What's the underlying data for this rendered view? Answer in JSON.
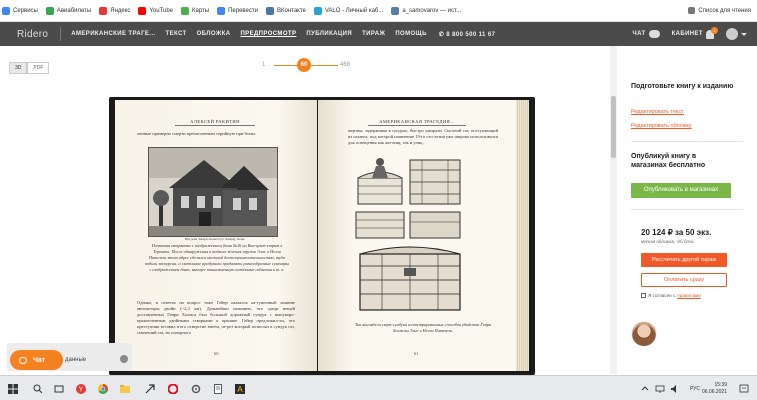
{
  "bookmarks": {
    "items": [
      {
        "label": "Сервисы",
        "icon": "apps-grid-icon",
        "color": "#4285f4"
      },
      {
        "label": "Авиабилеты",
        "icon": "plane-icon",
        "color": "#34a853"
      },
      {
        "label": "Яндекс",
        "icon": "yandex-icon",
        "color": "#e53935"
      },
      {
        "label": "YouTube",
        "icon": "youtube-icon",
        "color": "#ff0000"
      },
      {
        "label": "Карты",
        "icon": "maps-icon",
        "color": "#4caf50"
      },
      {
        "label": "Перевести",
        "icon": "translate-icon",
        "color": "#4285f4"
      },
      {
        "label": "ВКонтакте",
        "icon": "vk-icon",
        "color": "#4a76a8"
      },
      {
        "label": "VALO - Личный каб...",
        "icon": "valo-icon",
        "color": "#2aa0d6"
      },
      {
        "label": "a_samovarov — ист...",
        "icon": "livejournal-icon",
        "color": "#5a7fa6"
      }
    ],
    "reading_list": "Список для чтения"
  },
  "header": {
    "logo": "Ridero",
    "nav": [
      {
        "label": "АМЕРИКАНСКИЕ ТРАГЕ...",
        "active": false
      },
      {
        "label": "ТЕКСТ",
        "active": false
      },
      {
        "label": "ОБЛОЖКА",
        "active": false
      },
      {
        "label": "ПРЕДПРОСМОТР",
        "active": true
      },
      {
        "label": "ПУБЛИКАЦИЯ",
        "active": false
      },
      {
        "label": "ТИРАЖ",
        "active": false
      },
      {
        "label": "ПОМОЩЬ",
        "active": false
      }
    ],
    "phone": "8 800 500 11 67",
    "chat_label": "ЧАТ",
    "cabinet_label": "КАБИНЕТ",
    "notifications": "1"
  },
  "viewer": {
    "modes": [
      "3D",
      "PDF"
    ],
    "active_mode": "3D",
    "pager": {
      "min": "1",
      "current": "60",
      "max": "468"
    }
  },
  "book": {
    "left_page": {
      "running_head": "АЛЕКСЕЙ РАКИТИН",
      "top_text": "ленные примерно смерти пречисленным серийную при-боны.",
      "photo_caption_small": "Вид дома Эдварда Холмса (Ст. Ховард), Холмс",
      "caption": "Почтовая открытка с изображением дома №16 по Вин-цент-стрит в Торонто. После обнаружения в подвале зём-ная трупов Элис и Нелли Питезель этот адрес сделался местной достопримечательностью, туда водили экскурсии, а сметливое придумали продавать разнообразные сувениры с изображением дома, вьющее таинственную потёмные события и т. п.",
      "body": "Однако, в ответах на вопрос тоже Гейер оказался ка-тушенный лишние автомоторы двойн (~2,3 км). Дальнейши напомню, что среди вещей доставленных Генри Холмса был большой дорожный сундук с выпукоро-прокопченным двойными створками к крышке. Гейер предложил-ли, что преступник вставил в его отверстие змеем, че-рез который позволял в сундук газ, смочеший газ, но изнорного",
      "page_number": "60"
    },
    "right_page": {
      "running_head": "АМЕРИКАНСКАЯ ТРАГЕДИЯ...",
      "top_text": "жертвы, задерживая в сундуке, быстро умирали. Сыгчеий газ, поступающий из шланга, под которой появление 19-го сто-летия уже широко использовался для освещения как жи-лищ, так и улиц.",
      "caption": "Так выглядели сверх-сундуки иллюстрированных способов убийства Генри Холмсом Элис и Нелли Питезель.",
      "page_number": "61"
    }
  },
  "panel": {
    "prepare_title": "Подготовьте книгу к изданию",
    "edit_text": "Редактировать текст",
    "edit_cover": "Редактировать обложку",
    "publish_title": "Опубликуй книгу в магазинах бесплатно",
    "publish_button": "Опубликовать в магазинах",
    "price": "20 124 ₽  за 50 экз.",
    "price_sub": "мягкая обложка, ч/б блок.",
    "calc_button": "Рассчитать другой тираж",
    "pay_button": "Оплатить сразу",
    "agree_text": "Я согласен с",
    "agree_link": "правилами",
    "accent_color": "#f05a28",
    "publish_color": "#7ab648"
  },
  "chat_widget": {
    "button_label": "Чат",
    "text": "данные"
  },
  "taskbar": {
    "lang": "РУС",
    "time": "15:39",
    "date": "06.06.2021"
  }
}
